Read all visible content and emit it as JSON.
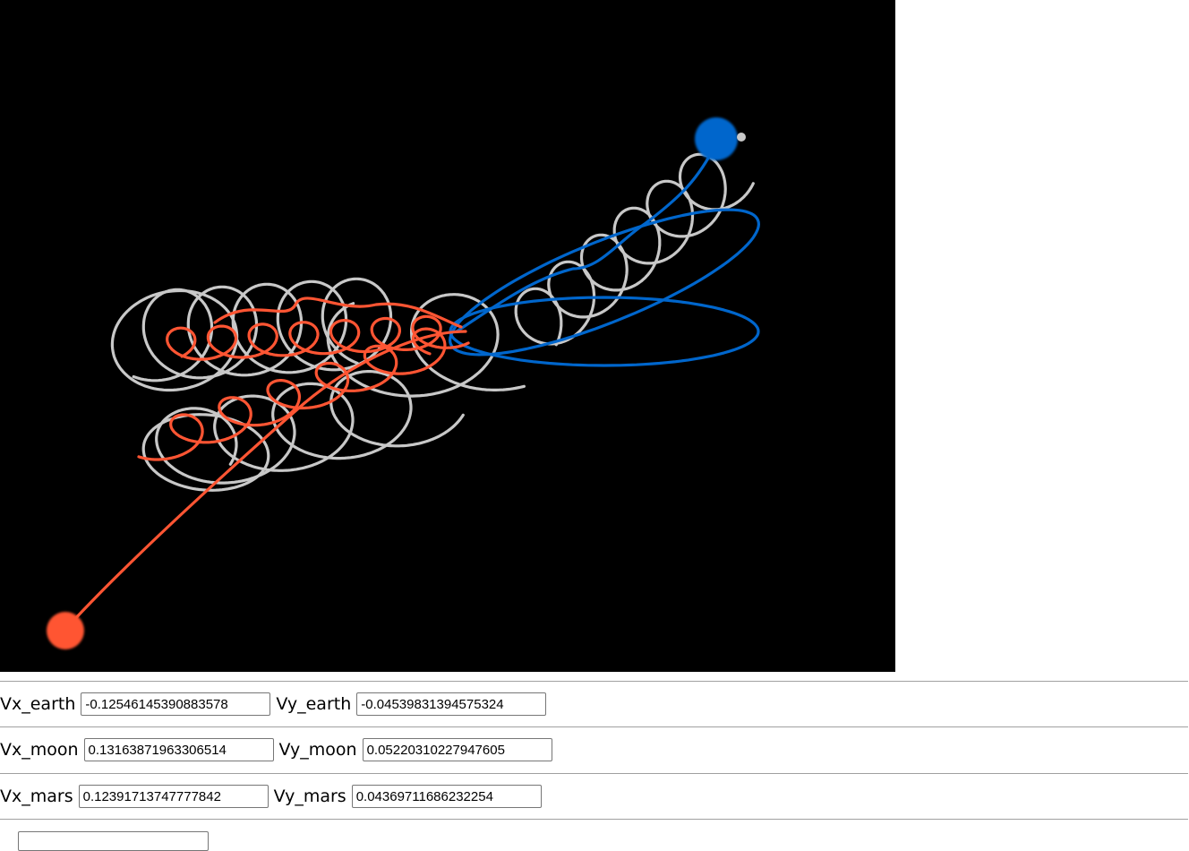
{
  "colors": {
    "canvas_bg": "#000000",
    "earth": "#0066cc",
    "moon": "#c8c8c8",
    "mars": "#ff5533"
  },
  "bodies": {
    "earth": {
      "icon": "blue-planet-icon"
    },
    "moon": {
      "icon": "moon-icon"
    },
    "mars": {
      "icon": "red-planet-icon"
    }
  },
  "controls": {
    "earth": {
      "vx_label": "Vx_earth",
      "vx_value": "-0.12546145390883578",
      "vy_label": "Vy_earth",
      "vy_value": "-0.04539831394575324"
    },
    "moon": {
      "vx_label": "Vx_moon",
      "vx_value": "0.13163871963306514",
      "vy_label": "Vy_moon",
      "vy_value": "0.05220310227947605"
    },
    "mars": {
      "vx_label": "Vx_mars",
      "vx_value": "0.12391713747777842",
      "vy_label": "Vy_mars",
      "vy_value": "0.04369711686232254"
    }
  }
}
